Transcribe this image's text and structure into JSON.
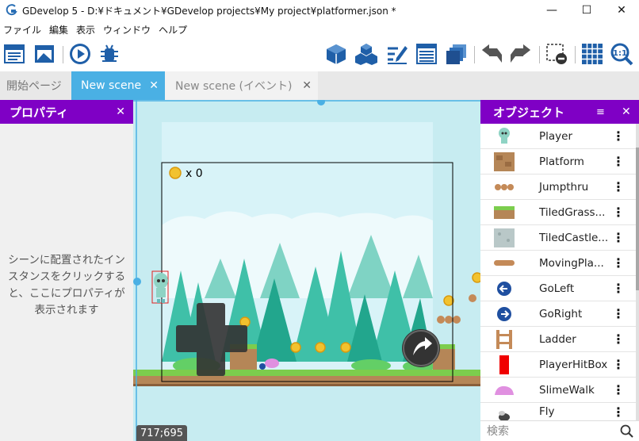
{
  "window": {
    "title": "GDevelop 5 - D:¥ドキュメント¥GDevelop projects¥My project¥platformer.json *",
    "minimize": "—",
    "maximize": "☐",
    "close": "✕"
  },
  "menu": [
    "ファイル",
    "編集",
    "表示",
    "ウィンドウ",
    "ヘルプ"
  ],
  "toolbar": {
    "left_icons": [
      "project-manager-icon",
      "scene-editor-icon",
      "preview-play-icon",
      "debugger-icon"
    ],
    "right_icons": [
      "edit-object-icon",
      "object-groups-icon",
      "properties-edit-icon",
      "instances-list-icon",
      "layers-icon",
      "undo-icon",
      "redo-icon",
      "delete-icon",
      "grid-icon",
      "zoom-reset-icon"
    ],
    "zoom_label": "1:1"
  },
  "tabs": [
    {
      "label": "開始ページ",
      "active": false,
      "closable": false
    },
    {
      "label": "New scene",
      "active": true,
      "closable": true
    },
    {
      "label": "New scene (イベント)",
      "active": false,
      "closable": true
    }
  ],
  "properties_panel": {
    "title": "プロパティ",
    "close": "✕",
    "empty_message": "シーンに配置されたインスタンスをクリックすると、ここにプロパティが表示されます"
  },
  "objects_panel": {
    "title": "オブジェクト",
    "close": "✕",
    "items": [
      {
        "name": "Player",
        "icon": "player-icon"
      },
      {
        "name": "Platform",
        "icon": "platform-icon"
      },
      {
        "name": "Jumpthru",
        "icon": "jumpthru-icon"
      },
      {
        "name": "TiledGrass...",
        "icon": "tiled-grass-icon"
      },
      {
        "name": "TiledCastle...",
        "icon": "tiled-castle-icon"
      },
      {
        "name": "MovingPla...",
        "icon": "moving-platform-icon"
      },
      {
        "name": "GoLeft",
        "icon": "go-left-icon"
      },
      {
        "name": "GoRight",
        "icon": "go-right-icon"
      },
      {
        "name": "Ladder",
        "icon": "ladder-icon"
      },
      {
        "name": "PlayerHitBox",
        "icon": "hitbox-icon"
      },
      {
        "name": "SlimeWalk",
        "icon": "slime-icon"
      },
      {
        "name": "Fly",
        "icon": "fly-icon"
      }
    ],
    "menu_glyph": "⋮",
    "search_placeholder": "検索"
  },
  "scene": {
    "coin_counter": "x 0",
    "cursor_coordinates": "717;695"
  },
  "colors": {
    "accent_purple": "#7f00c5",
    "active_tab": "#4ab0e4",
    "toolbar_blue": "#1f5fa8",
    "sky": "#d6f1f8"
  }
}
